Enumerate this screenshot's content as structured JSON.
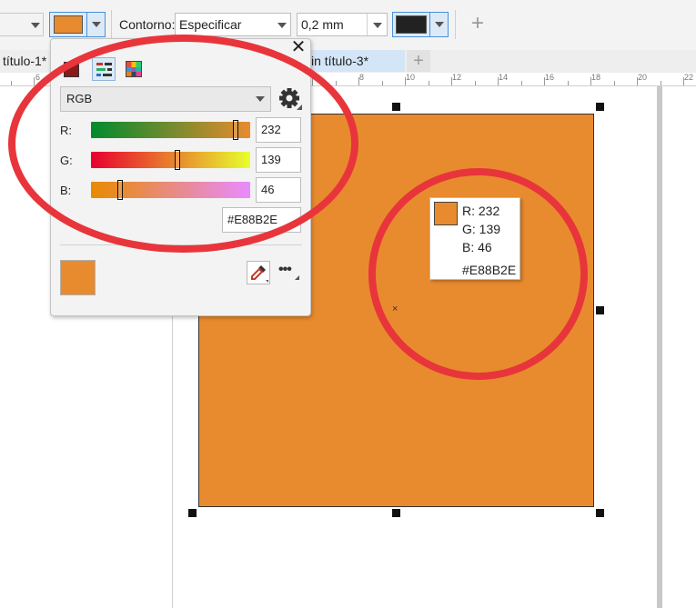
{
  "propbar": {
    "outline_label": "Contorno:",
    "outline_style_value": "Especificar",
    "outline_width_value": "0,2 mm",
    "add_icon": "plus-icon"
  },
  "colors": {
    "fill": "#E88B2E",
    "outline": "#222222",
    "annotation": "#E8353B"
  },
  "tabs": [
    {
      "label": "título-1*"
    },
    {
      "label": "in título-3*"
    }
  ],
  "ruler": {
    "labels": [
      "6",
      "8",
      "10",
      "12",
      "14",
      "16",
      "18",
      "20",
      "22"
    ]
  },
  "popup": {
    "close_icon": "close-icon",
    "model": "RGB",
    "channels": [
      {
        "label": "R:",
        "value": "232",
        "fraction": 0.91
      },
      {
        "label": "G:",
        "value": "139",
        "fraction": 0.545
      },
      {
        "label": "B:",
        "value": "46",
        "fraction": 0.18
      }
    ],
    "hex": "#E88B2E"
  },
  "tooltip": {
    "r": "R: 232",
    "g": "G: 139",
    "b": "B: 46",
    "hex": "#E88B2E"
  }
}
